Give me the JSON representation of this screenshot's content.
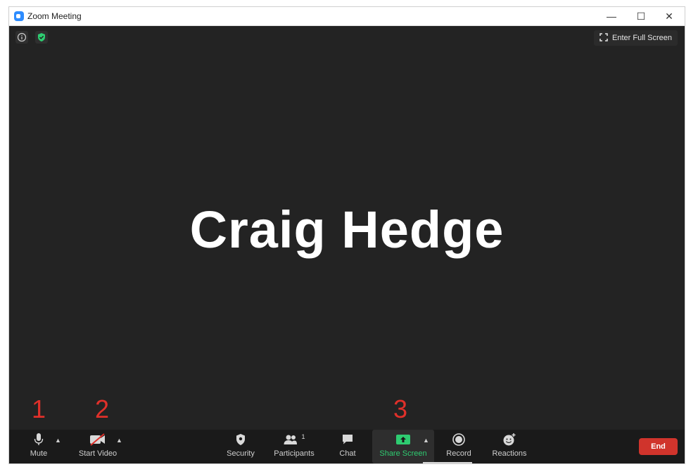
{
  "window": {
    "title": "Zoom Meeting",
    "controls": {
      "minimize": "—",
      "maximize": "☐",
      "close": "✕"
    }
  },
  "meeting": {
    "fullscreen_label": "Enter Full Screen",
    "participant_name": "Craig Hedge"
  },
  "markers": [
    "1",
    "2",
    "3"
  ],
  "toolbar": {
    "mute": "Mute",
    "start_video": "Start Video",
    "security": "Security",
    "participants": "Participants",
    "participants_count": "1",
    "chat": "Chat",
    "share_screen": "Share Screen",
    "record": "Record",
    "reactions": "Reactions",
    "end": "End"
  },
  "colors": {
    "meeting_bg": "#232323",
    "toolbar_bg": "#1a1a1a",
    "share_green": "#2ecc71",
    "end_red": "#d0342c",
    "marker_red": "#e0302a"
  },
  "icons": [
    "zoom-app-icon",
    "info-icon",
    "shield-check-icon",
    "fullscreen-icon",
    "microphone-icon",
    "video-off-icon",
    "security-shield-icon",
    "participants-icon",
    "chat-icon",
    "share-screen-icon",
    "record-icon",
    "reactions-icon",
    "caret-up-icon"
  ]
}
